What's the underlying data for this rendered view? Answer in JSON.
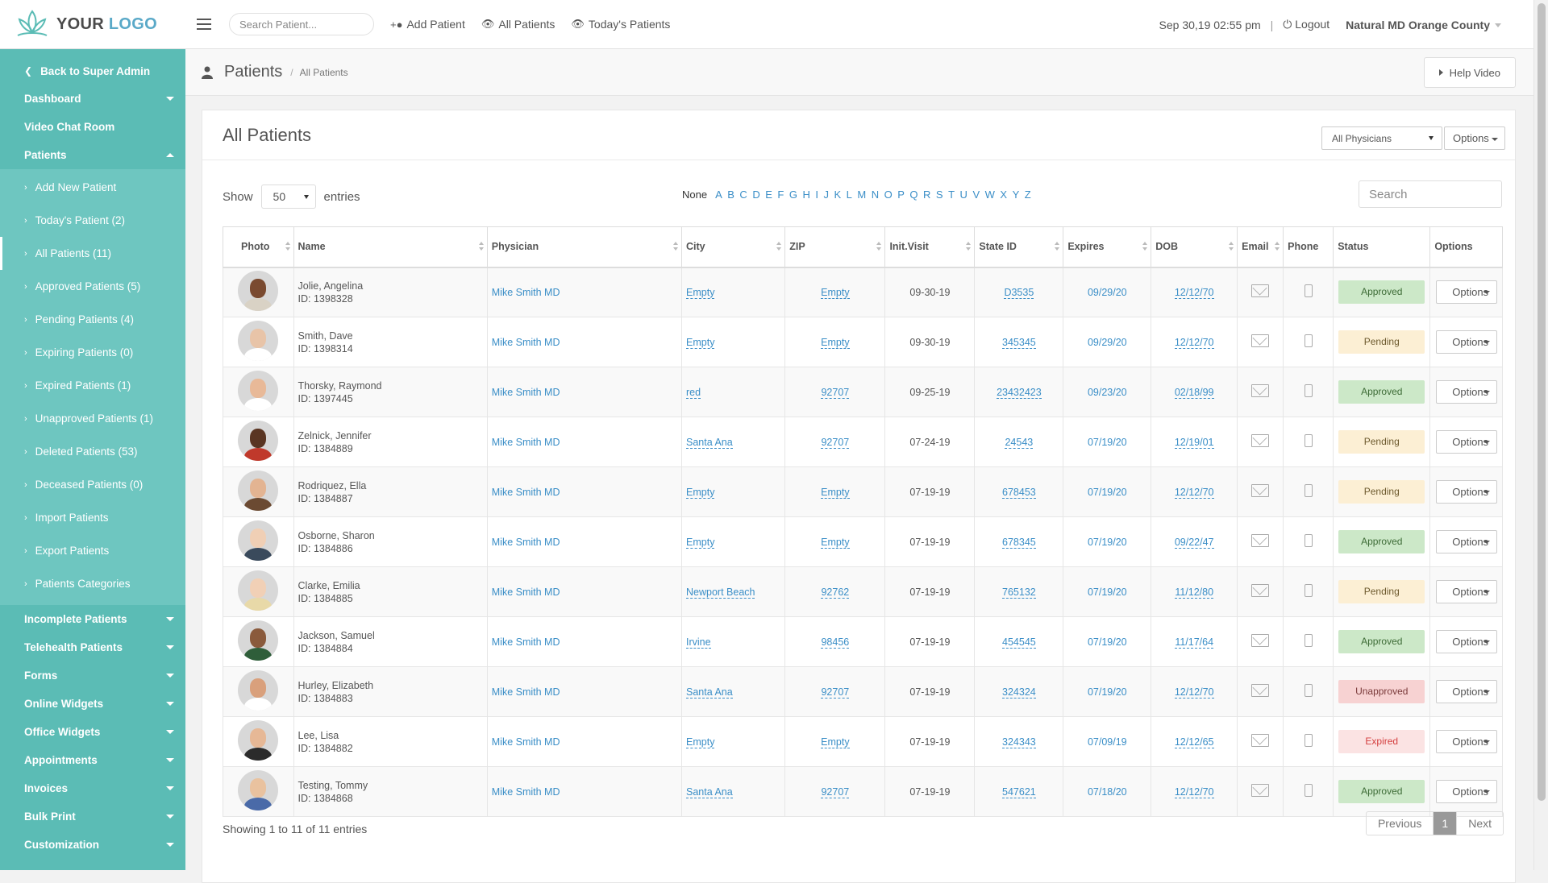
{
  "header": {
    "logo_text_1": "YOUR",
    "logo_text_2": "LOGO",
    "search_placeholder": "Search Patient...",
    "links": [
      "Add Patient",
      "All Patients",
      "Today's Patients"
    ],
    "datetime": "Sep 30,19 02:55 pm",
    "separator": "|",
    "logout": "Logout",
    "clinic": "Natural MD Orange County"
  },
  "sidebar": {
    "back": "Back to Super Admin",
    "top_items": [
      {
        "label": "Dashboard",
        "arrow": "down"
      },
      {
        "label": "Video Chat Room",
        "arrow": ""
      },
      {
        "label": "Patients",
        "arrow": "up"
      }
    ],
    "sub_items": [
      "Add New Patient",
      "Today's Patient (2)",
      "All Patients (11)",
      "Approved Patients (5)",
      "Pending Patients (4)",
      "Expiring Patients (0)",
      "Expired Patients (1)",
      "Unapproved Patients (1)",
      "Deleted Patients (53)",
      "Deceased Patients (0)",
      "Import Patients",
      "Export Patients",
      "Patients Categories"
    ],
    "active_sub": 2,
    "bottom_items": [
      "Incomplete Patients",
      "Telehealth Patients",
      "Forms",
      "Online Widgets",
      "Office Widgets",
      "Appointments",
      "Invoices",
      "Bulk Print",
      "Customization"
    ]
  },
  "page": {
    "title": "Patients",
    "breadcrumb_sep": "/",
    "breadcrumb": "All Patients",
    "help": "Help Video"
  },
  "panel": {
    "title": "All Patients",
    "physician_select": "All Physicians",
    "options": "Options",
    "show_label": "Show",
    "entries_value": "50",
    "entries_label": "entries",
    "alpha_none": "None",
    "letters": [
      "A",
      "B",
      "C",
      "D",
      "E",
      "F",
      "G",
      "H",
      "I",
      "J",
      "K",
      "L",
      "M",
      "N",
      "O",
      "P",
      "Q",
      "R",
      "S",
      "T",
      "U",
      "V",
      "W",
      "X",
      "Y",
      "Z"
    ],
    "search_placeholder": "Search",
    "footer": "Showing 1 to 11 of 11 entries",
    "pager": {
      "prev": "Previous",
      "current": "1",
      "next": "Next"
    }
  },
  "table": {
    "columns": [
      "Photo",
      "Name",
      "Physician",
      "City",
      "ZIP",
      "Init.Visit",
      "State ID",
      "Expires",
      "DOB",
      "Email",
      "Phone",
      "Status",
      "Options"
    ],
    "rows": [
      {
        "name": "Jolie, Angelina",
        "id": "ID: 1398328",
        "physician": "Mike Smith MD",
        "city": "Empty",
        "zip": "Empty",
        "visit": "09-30-19",
        "state_id": "D3535",
        "expires": "09/29/20",
        "dob": "12/12/70",
        "status": "Approved",
        "status_class": "approved",
        "option": "Options",
        "skin": "#7a4a30",
        "shirt": "#d9d2c5"
      },
      {
        "name": "Smith, Dave",
        "id": "ID: 1398314",
        "physician": "Mike Smith MD",
        "city": "Empty",
        "zip": "Empty",
        "visit": "09-30-19",
        "state_id": "345345",
        "expires": "09/29/20",
        "dob": "12/12/70",
        "status": "Pending",
        "status_class": "pending",
        "option": "Options",
        "skin": "#e8c4a8",
        "shirt": "#ffffff"
      },
      {
        "name": "Thorsky, Raymond",
        "id": "ID: 1397445",
        "physician": "Mike Smith MD",
        "city": "red",
        "zip": "92707",
        "visit": "09-25-19",
        "state_id": "23432423",
        "expires": "09/23/20",
        "dob": "02/18/99",
        "status": "Approved",
        "status_class": "approved",
        "option": "Options",
        "skin": "#e8b998",
        "shirt": "#ffffff"
      },
      {
        "name": "Zelnick, Jennifer",
        "id": "ID: 1384889",
        "physician": "Mike Smith MD",
        "city": "Santa Ana",
        "zip": "92707",
        "visit": "07-24-19",
        "state_id": "24543",
        "expires": "07/19/20",
        "dob": "12/19/01",
        "status": "Pending",
        "status_class": "pending",
        "option": "Options",
        "skin": "#5a3522",
        "shirt": "#c0392b"
      },
      {
        "name": "Rodriquez, Ella",
        "id": "ID: 1384887",
        "physician": "Mike Smith MD",
        "city": "Empty",
        "zip": "Empty",
        "visit": "07-19-19",
        "state_id": "678453",
        "expires": "07/19/20",
        "dob": "12/12/70",
        "status": "Pending",
        "status_class": "pending",
        "option": "Options",
        "skin": "#e3b492",
        "shirt": "#6b4a32"
      },
      {
        "name": "Osborne, Sharon",
        "id": "ID: 1384886",
        "physician": "Mike Smith MD",
        "city": "Empty",
        "zip": "Empty",
        "visit": "07-19-19",
        "state_id": "678345",
        "expires": "07/19/20",
        "dob": "09/22/47",
        "status": "Approved",
        "status_class": "approved",
        "option": "Options",
        "skin": "#f0cfb5",
        "shirt": "#3a4a5c"
      },
      {
        "name": "Clarke, Emilia",
        "id": "ID: 1384885",
        "physician": "Mike Smith MD",
        "city": "Newport Beach",
        "zip": "92762",
        "visit": "07-19-19",
        "state_id": "765132",
        "expires": "07/19/20",
        "dob": "11/12/80",
        "status": "Pending",
        "status_class": "pending",
        "option": "Options",
        "skin": "#f1d0b6",
        "shirt": "#e8d9a8"
      },
      {
        "name": "Jackson, Samuel",
        "id": "ID: 1384884",
        "physician": "Mike Smith MD",
        "city": "Irvine",
        "zip": "98456",
        "visit": "07-19-19",
        "state_id": "454545",
        "expires": "07/19/20",
        "dob": "11/17/64",
        "status": "Approved",
        "status_class": "approved",
        "option": "Options",
        "skin": "#8a5a3c",
        "shirt": "#2f5e3a"
      },
      {
        "name": "Hurley, Elizabeth",
        "id": "ID: 1384883",
        "physician": "Mike Smith MD",
        "city": "Santa Ana",
        "zip": "92707",
        "visit": "07-19-19",
        "state_id": "324324",
        "expires": "07/19/20",
        "dob": "12/12/70",
        "status": "Unapproved",
        "status_class": "unapproved",
        "option": "Options",
        "skin": "#d9a07c",
        "shirt": "#ffffff"
      },
      {
        "name": "Lee, Lisa",
        "id": "ID: 1384882",
        "physician": "Mike Smith MD",
        "city": "Empty",
        "zip": "Empty",
        "visit": "07-19-19",
        "state_id": "324343",
        "expires": "07/09/19",
        "dob": "12/12/65",
        "status": "Expired",
        "status_class": "expired",
        "option": "Options",
        "skin": "#e6b896",
        "shirt": "#2b2b2b"
      },
      {
        "name": "Testing, Tommy",
        "id": "ID: 1384868",
        "physician": "Mike Smith MD",
        "city": "Santa Ana",
        "zip": "92707",
        "visit": "07-19-19",
        "state_id": "547621",
        "expires": "07/18/20",
        "dob": "12/12/70",
        "status": "Approved",
        "status_class": "approved",
        "option": "Options",
        "skin": "#e9c29f",
        "shirt": "#4a6aa8"
      }
    ]
  }
}
